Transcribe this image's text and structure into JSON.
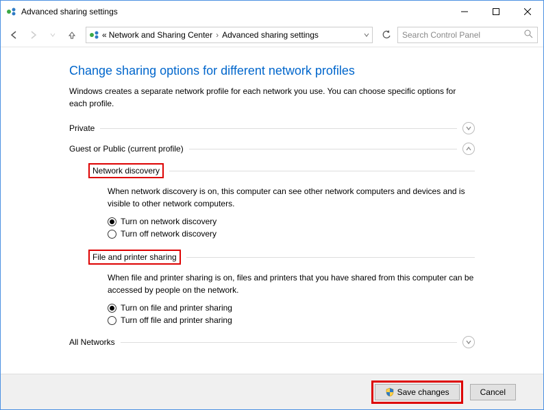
{
  "window": {
    "title": "Advanced sharing settings"
  },
  "breadcrumb": {
    "root": "«",
    "item1": "Network and Sharing Center",
    "item2": "Advanced sharing settings"
  },
  "search": {
    "placeholder": "Search Control Panel"
  },
  "page": {
    "title": "Change sharing options for different network profiles",
    "description": "Windows creates a separate network profile for each network you use. You can choose specific options for each profile."
  },
  "sections": {
    "private": {
      "title": "Private"
    },
    "guest": {
      "title": "Guest or Public (current profile)",
      "network_discovery": {
        "title": "Network discovery",
        "description": "When network discovery is on, this computer can see other network computers and devices and is visible to other network computers.",
        "option_on": "Turn on network discovery",
        "option_off": "Turn off network discovery"
      },
      "file_printer": {
        "title": "File and printer sharing",
        "description": "When file and printer sharing is on, files and printers that you have shared from this computer can be accessed by people on the network.",
        "option_on": "Turn on file and printer sharing",
        "option_off": "Turn off file and printer sharing"
      }
    },
    "all_networks": {
      "title": "All Networks"
    }
  },
  "footer": {
    "save": "Save changes",
    "cancel": "Cancel"
  }
}
